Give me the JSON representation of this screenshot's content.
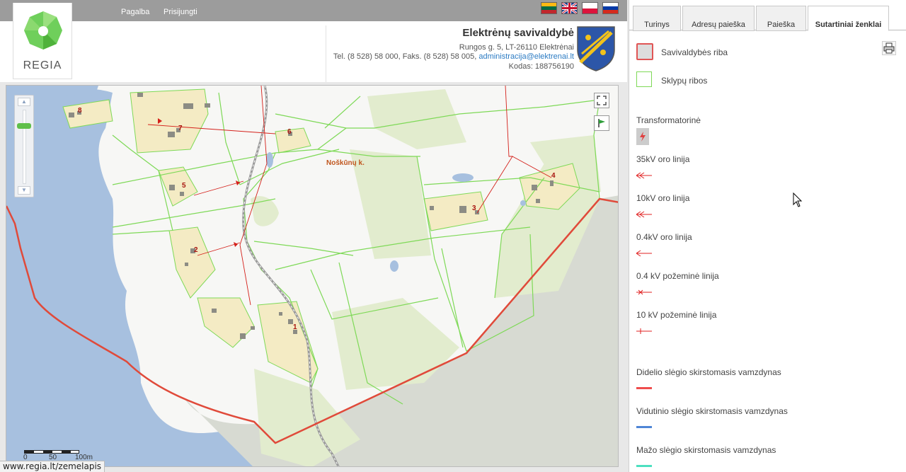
{
  "topbar": {
    "links": [
      "Pagalba",
      "Prisijungti"
    ],
    "flags": [
      "lithuanian-flag-icon",
      "english-flag-icon",
      "polish-flag-icon",
      "russian-flag-icon"
    ]
  },
  "header": {
    "logo_text": "REGIA",
    "municipality": {
      "name": "Elektrėnų savivaldybė",
      "address": "Rungos g. 5, LT-26110 Elektrėnai",
      "contacts": "Tel. (8 528) 58 000, Faks. (8 528) 58 005,",
      "email": "administracija@elektrenai.lt",
      "code": "Kodas: 188756190"
    }
  },
  "map": {
    "place_label": "Noškūnų k.",
    "parcel_numbers": [
      "1",
      "2",
      "4",
      "5",
      "6",
      "7",
      "8",
      "3"
    ],
    "scale": {
      "labels": [
        "0",
        "50",
        "100m"
      ]
    },
    "zoom": {
      "plus": "▲",
      "minus": "▼"
    }
  },
  "panel": {
    "tabs": [
      {
        "label": "Turinys",
        "active": false
      },
      {
        "label": "Adresų paieška",
        "active": false
      },
      {
        "label": "Paieška",
        "active": false
      },
      {
        "label": "Sutartiniai ženklai",
        "active": true
      }
    ],
    "legend": [
      {
        "label": "Savivaldybės riba",
        "symbol": "square-red",
        "color": "#e05555"
      },
      {
        "label": "Sklypų ribos",
        "symbol": "square-green",
        "color": "#7ed957"
      },
      {
        "label": "Transformatorinė",
        "symbol": "transformer-icon",
        "color": "#e04040"
      },
      {
        "label": "35kV oro linija",
        "symbol": "line-arrow",
        "color": "#e02020"
      },
      {
        "label": "10kV oro linija",
        "symbol": "line-arrow",
        "color": "#e02020"
      },
      {
        "label": "0.4kV oro linija",
        "symbol": "line-arrow",
        "color": "#e02020"
      },
      {
        "label": "0.4 kV požeminė linija",
        "symbol": "line-x",
        "color": "#e02020"
      },
      {
        "label": "10 kV požeminė linija",
        "symbol": "line-tick",
        "color": "#e02020"
      },
      {
        "label": "Didelio slėgio skirstomasis vamzdynas",
        "symbol": "bar",
        "color": "#ef4d4d"
      },
      {
        "label": "Vidutinio slėgio skirstomasis vamzdynas",
        "symbol": "bar",
        "color": "#4f86d6"
      },
      {
        "label": "Mažo slėgio skirstomasis vamzdynas",
        "symbol": "bar",
        "color": "#4de0c0"
      }
    ]
  },
  "status_url": "www.regia.lt/zemelapis"
}
